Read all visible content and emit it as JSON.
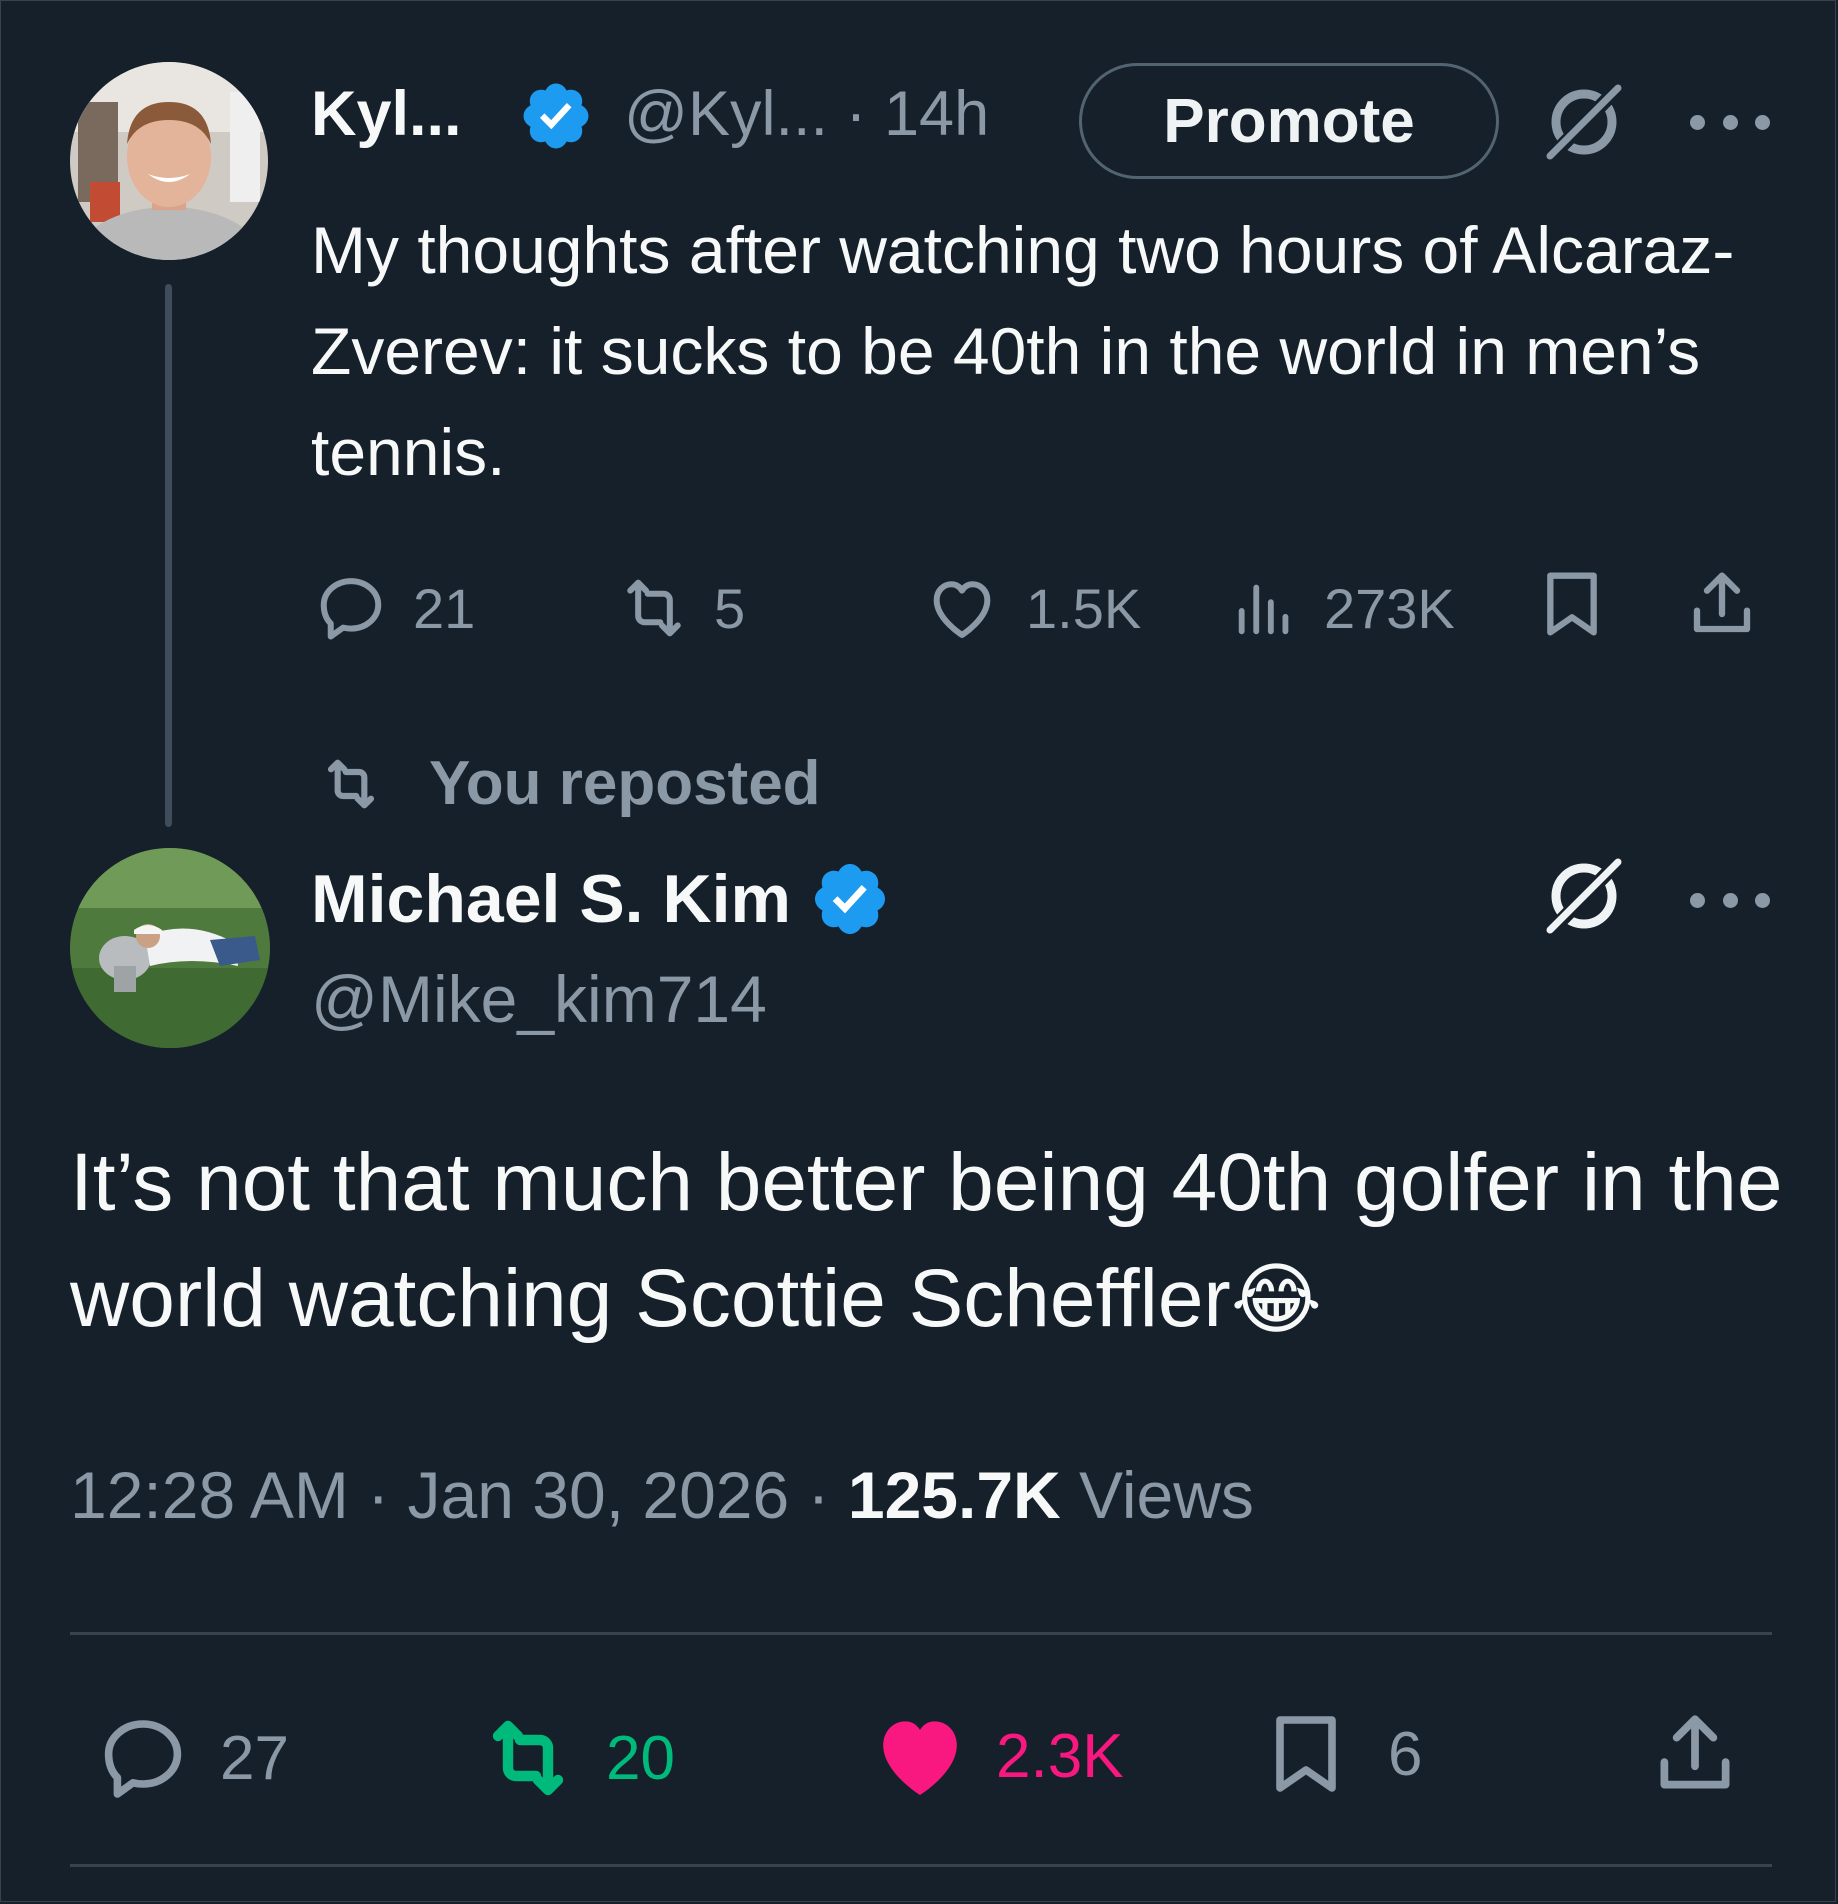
{
  "parent_tweet": {
    "author_name": "Kyl...",
    "handle": "@Kyl...",
    "separator": "·",
    "time_ago": "14h",
    "promote_label": "Promote",
    "text": "My thoughts after watching two hours of Alcaraz-Zverev: it sucks to be 40th in the world in men’s tennis.",
    "stats": {
      "replies": "21",
      "reposts": "5",
      "likes": "1.5K",
      "views": "273K"
    }
  },
  "repost_note": "You reposted",
  "main_tweet": {
    "author_name": "Michael S. Kim",
    "handle": "@Mike_kim714",
    "text": "It’s not that much better being 40th golfer in the world watching Scottie Scheffler",
    "emoji": "😂",
    "time": "12:28 AM",
    "separator": "·",
    "date": "Jan 30, 2026",
    "views_count": "125.7K",
    "views_label": "Views",
    "stats": {
      "replies": "27",
      "reposts": "20",
      "likes": "2.3K",
      "bookmarks": "6"
    }
  },
  "colors": {
    "background": "#15202b",
    "verified": "#1d9bf0",
    "repost_active": "#00ba7c",
    "like_active": "#f91880",
    "muted_text": "#8b98a5"
  },
  "icons": [
    "verified-badge-icon",
    "grok-icon",
    "more-icon",
    "reply-icon",
    "repost-icon",
    "like-icon",
    "views-icon",
    "bookmark-icon",
    "share-icon"
  ]
}
